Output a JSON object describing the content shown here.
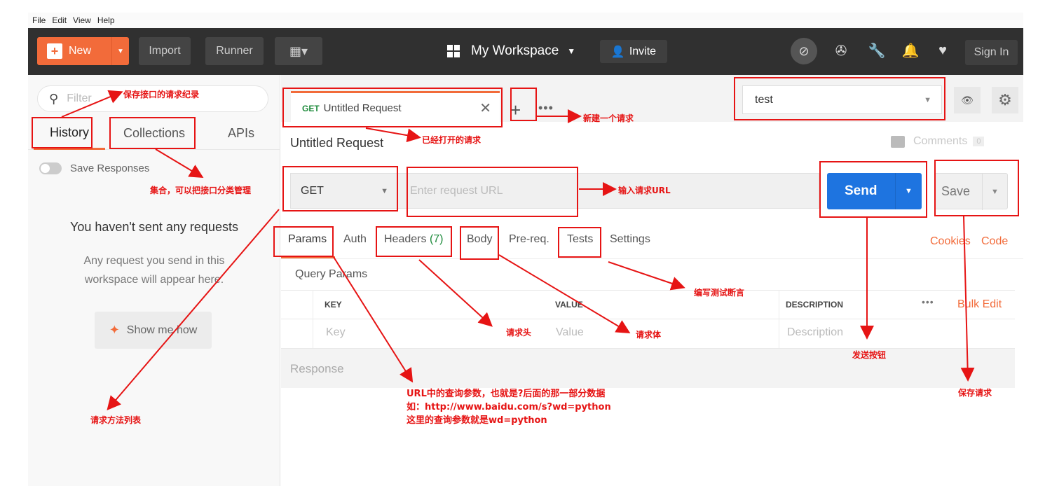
{
  "menu": [
    "File",
    "Edit",
    "View",
    "Help"
  ],
  "header": {
    "new_label": "New",
    "import_label": "Import",
    "runner_label": "Runner",
    "workspace_label": "My Workspace",
    "invite_label": "Invite",
    "signin_label": "Sign In"
  },
  "sidebar": {
    "filter_placeholder": "Filter",
    "tabs": [
      "History",
      "Collections",
      "APIs"
    ],
    "active_tab": "History",
    "save_responses_label": "Save Responses",
    "empty_title": "You haven't sent any requests",
    "empty_sub": "Any request you send in this workspace will appear here.",
    "show_me_label": "Show me how"
  },
  "main": {
    "tab": {
      "method": "GET",
      "title": "Untitled Request"
    },
    "environment": "test",
    "request_title": "Untitled Request",
    "comments_label": "Comments",
    "comments_count": "0",
    "method": "GET",
    "url_placeholder": "Enter request URL",
    "send_label": "Send",
    "save_label": "Save",
    "request_tabs": [
      {
        "label": "Params"
      },
      {
        "label": "Auth"
      },
      {
        "label": "Headers",
        "count": "(7)"
      },
      {
        "label": "Body"
      },
      {
        "label": "Pre-req."
      },
      {
        "label": "Tests"
      },
      {
        "label": "Settings"
      }
    ],
    "cookies_label": "Cookies",
    "code_label": "Code",
    "query_params_label": "Query Params",
    "table_headers": [
      "KEY",
      "VALUE",
      "DESCRIPTION"
    ],
    "bulk_edit_label": "Bulk Edit",
    "row_placeholders": [
      "Key",
      "Value",
      "Description"
    ],
    "response_label": "Response"
  },
  "annotations": {
    "history": "保存接口的请求纪录",
    "new_request": "新建一个请求",
    "opened_request": "已经打开的请求",
    "collections": "集合，可以把接口分类管理",
    "url": "输入请求URL",
    "tests": "编写测试断言",
    "headers": "请求头",
    "body": "请求体",
    "send": "发送按钮",
    "save": "保存请求",
    "method_list": "请求方法列表",
    "params_line1": "URL中的查询参数，也就是?后面的那一部分数据",
    "params_line2": "如：http://www.baidu.com/s?wd=python",
    "params_line3": "这里的查询参数就是wd=python"
  },
  "colors": {
    "accent": "#f26b3a",
    "send": "#1e74e0",
    "annotation": "#e61414",
    "header_bg": "#303030"
  }
}
